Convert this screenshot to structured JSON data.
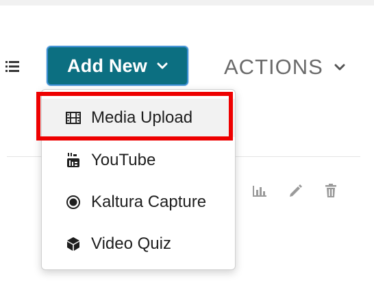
{
  "toolbar": {
    "add_new_label": "Add New",
    "actions_label": "ACTIONS"
  },
  "dropdown": {
    "items": [
      {
        "label": "Media Upload",
        "icon": "film-icon"
      },
      {
        "label": "YouTube",
        "icon": "youtube-icon"
      },
      {
        "label": "Kaltura Capture",
        "icon": "record-icon"
      },
      {
        "label": "Video Quiz",
        "icon": "cube-icon"
      }
    ]
  },
  "row_actions": {
    "icons": [
      "bar-chart-icon",
      "pencil-icon",
      "trash-icon"
    ]
  },
  "colors": {
    "button_bg": "#0c6f81",
    "highlight": "#ee0000",
    "muted_text": "#6a6a6a"
  }
}
